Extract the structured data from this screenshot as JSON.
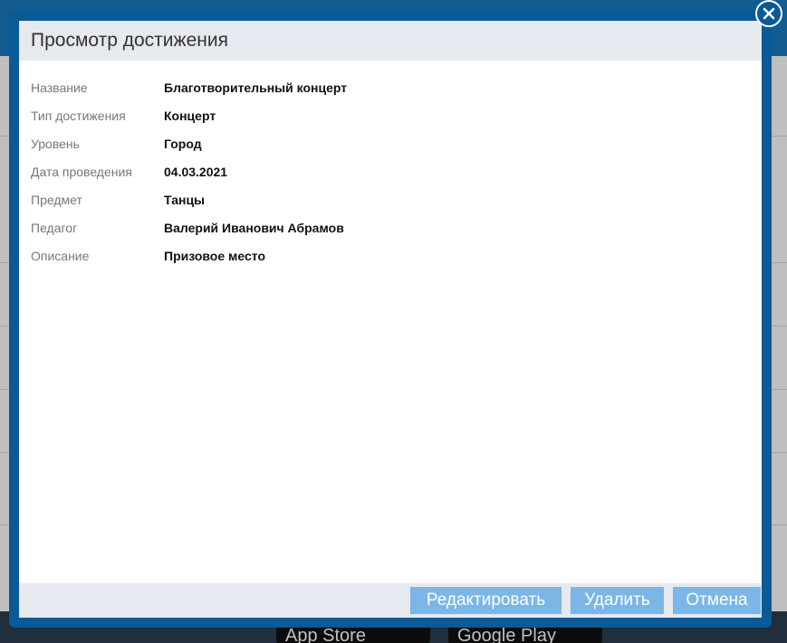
{
  "modal": {
    "title": "Просмотр достижения",
    "fields": [
      {
        "label": "Название",
        "value": "Благотворительный концерт"
      },
      {
        "label": "Тип достижения",
        "value": "Концерт"
      },
      {
        "label": "Уровень",
        "value": "Город"
      },
      {
        "label": "Дата проведения",
        "value": "04.03.2021"
      },
      {
        "label": "Предмет",
        "value": "Танцы"
      },
      {
        "label": "Педагог",
        "value": "Валерий Иванович Абрамов"
      },
      {
        "label": "Описание",
        "value": "Призовое место"
      }
    ],
    "buttons": {
      "edit": "Редактировать",
      "delete": "Удалить",
      "cancel": "Отмена"
    },
    "close_icon": "close-icon"
  },
  "background": {
    "store_badges": [
      "App Store",
      "Google Play"
    ]
  },
  "colors": {
    "modal_border": "#0a5a97",
    "titlebar_bg": "#e6e9ef",
    "button_bg": "#7bb6e6",
    "label_text": "#777777"
  }
}
